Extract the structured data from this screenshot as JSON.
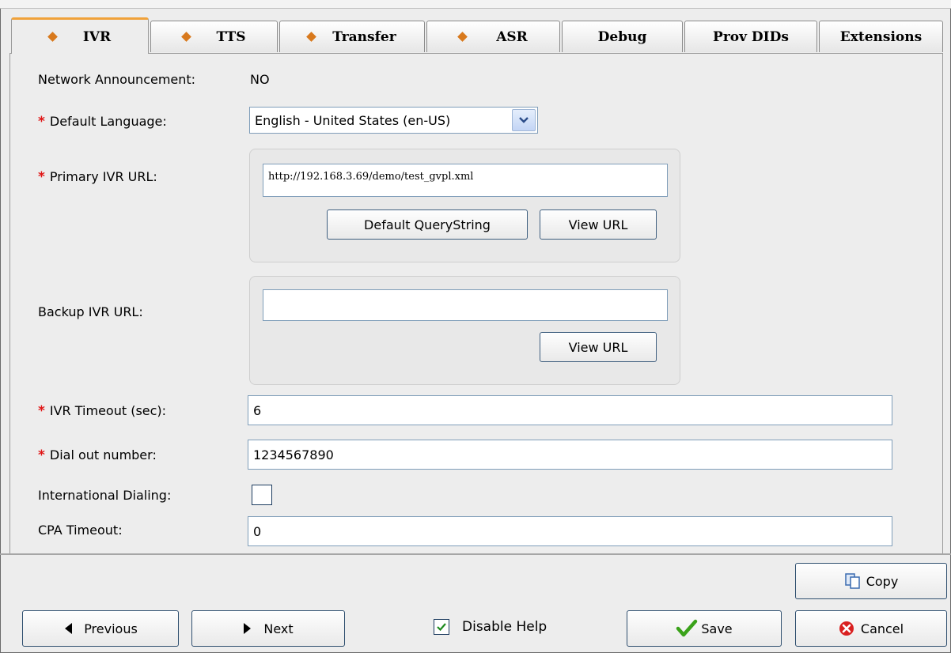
{
  "tabs": [
    {
      "label": "IVR",
      "marked": true,
      "active": true
    },
    {
      "label": "TTS",
      "marked": true,
      "active": false
    },
    {
      "label": "Transfer",
      "marked": true,
      "active": false
    },
    {
      "label": "ASR",
      "marked": true,
      "active": false
    },
    {
      "label": "Debug",
      "marked": false,
      "active": false
    },
    {
      "label": "Prov DIDs",
      "marked": false,
      "active": false
    },
    {
      "label": "Extensions",
      "marked": false,
      "active": false
    }
  ],
  "form": {
    "network_announcement": {
      "label": "Network Announcement:",
      "value": "NO"
    },
    "default_language": {
      "label": "Default Language:",
      "value": "English - United States (en-US)"
    },
    "primary_ivr_url": {
      "label": "Primary IVR URL:",
      "value": "http://192.168.3.69/demo/test_gvpl.xml",
      "default_qs_label": "Default QueryString",
      "view_url_label": "View URL"
    },
    "backup_ivr_url": {
      "label": "Backup IVR URL:",
      "value": "",
      "view_url_label": "View URL"
    },
    "ivr_timeout": {
      "label": "IVR Timeout (sec):",
      "value": "6"
    },
    "dial_out_number": {
      "label": "Dial out number:",
      "value": "1234567890"
    },
    "international_dialing": {
      "label": "International Dialing:",
      "checked": false
    },
    "cpa_timeout": {
      "label": "CPA Timeout:",
      "value": "0"
    }
  },
  "required_marker": "*",
  "footer": {
    "copy_label": "Copy",
    "previous_label": "Previous",
    "next_label": "Next",
    "disable_help_label": "Disable Help",
    "disable_help_checked": true,
    "save_label": "Save",
    "cancel_label": "Cancel"
  },
  "colors": {
    "accent": "#d8791d",
    "required": "#e01515",
    "save_check": "#3aa21a",
    "cancel": "#d92020"
  }
}
